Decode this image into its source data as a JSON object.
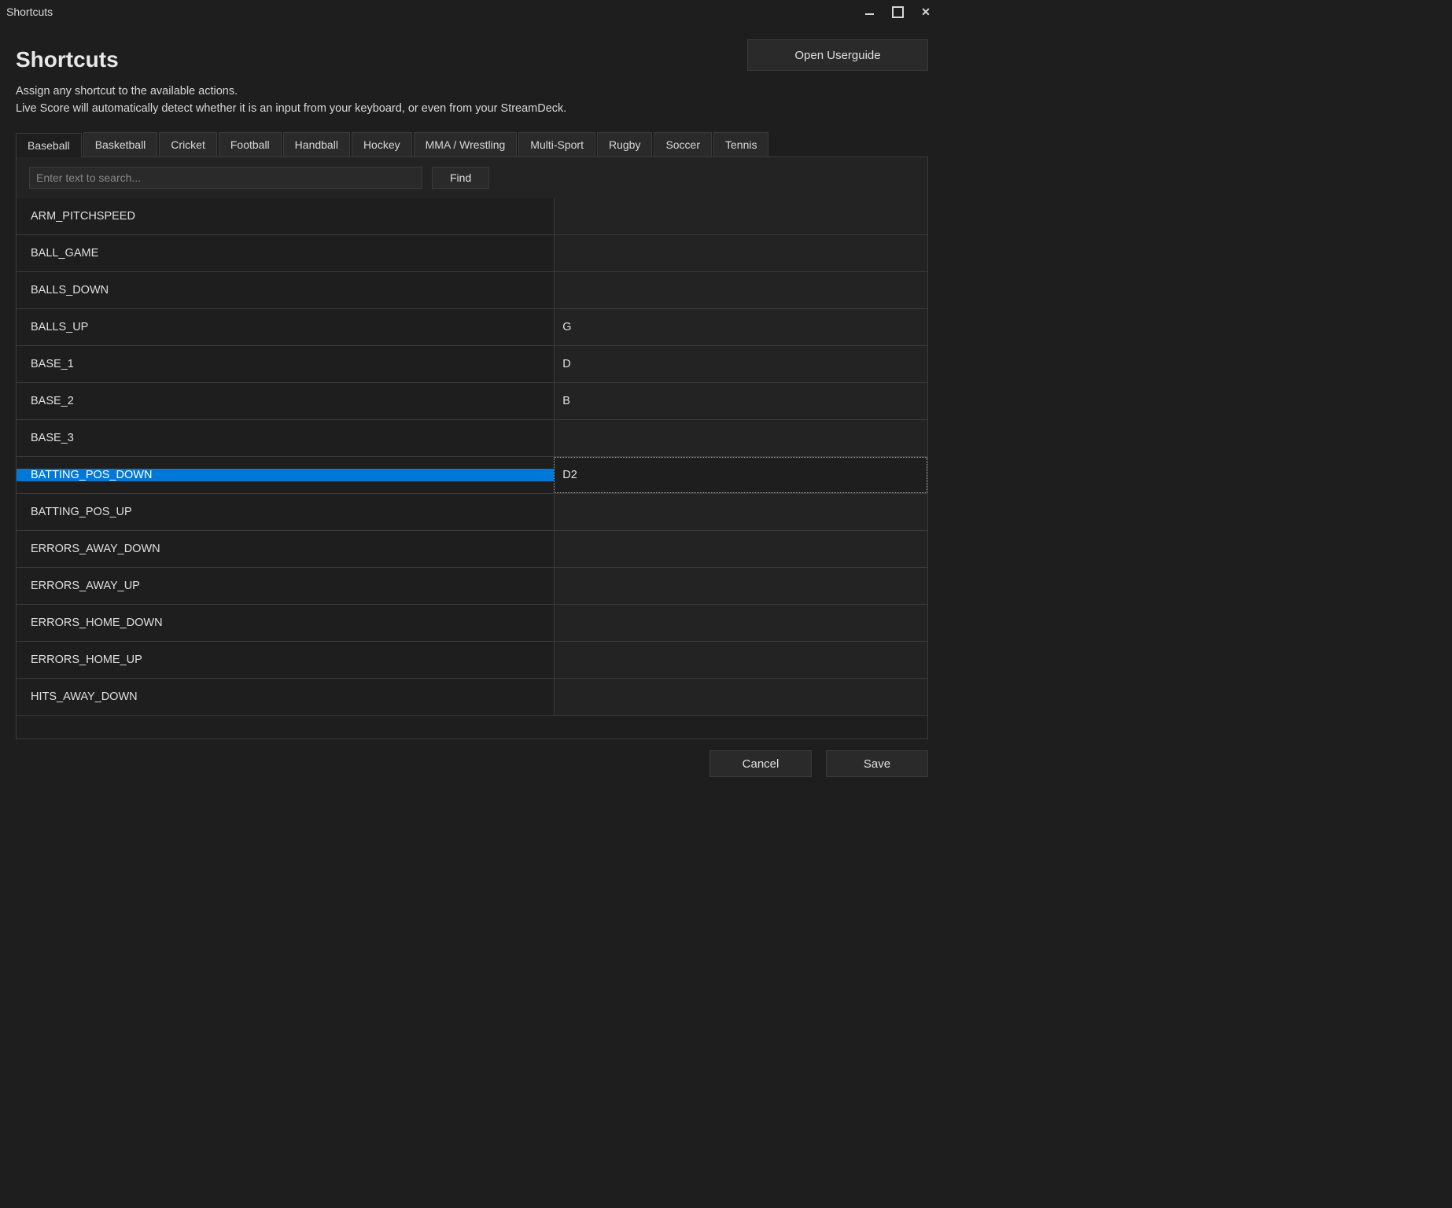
{
  "window": {
    "title": "Shortcuts"
  },
  "header": {
    "title": "Shortcuts",
    "open_guide": "Open Userguide",
    "subtitle_line1": "Assign any shortcut to the available actions.",
    "subtitle_line2": "Live Score will automatically detect whether it is an input from your keyboard, or even from your StreamDeck."
  },
  "tabs": [
    {
      "label": "Baseball",
      "active": true
    },
    {
      "label": "Basketball",
      "active": false
    },
    {
      "label": "Cricket",
      "active": false
    },
    {
      "label": "Football",
      "active": false
    },
    {
      "label": "Handball",
      "active": false
    },
    {
      "label": "Hockey",
      "active": false
    },
    {
      "label": "MMA / Wrestling",
      "active": false
    },
    {
      "label": "Multi-Sport",
      "active": false
    },
    {
      "label": "Rugby",
      "active": false
    },
    {
      "label": "Soccer",
      "active": false
    },
    {
      "label": "Tennis",
      "active": false
    }
  ],
  "search": {
    "placeholder": "Enter text to search...",
    "find": "Find"
  },
  "rows": [
    {
      "action": "ARM_PITCHSPEED",
      "key": "",
      "selected": false
    },
    {
      "action": "BALL_GAME",
      "key": "",
      "selected": false
    },
    {
      "action": "BALLS_DOWN",
      "key": "",
      "selected": false
    },
    {
      "action": "BALLS_UP",
      "key": "G",
      "selected": false
    },
    {
      "action": "BASE_1",
      "key": "D",
      "selected": false
    },
    {
      "action": "BASE_2",
      "key": "B",
      "selected": false
    },
    {
      "action": "BASE_3",
      "key": "",
      "selected": false
    },
    {
      "action": "BATTING_POS_DOWN",
      "key": "D2",
      "selected": true
    },
    {
      "action": "BATTING_POS_UP",
      "key": "",
      "selected": false
    },
    {
      "action": "ERRORS_AWAY_DOWN",
      "key": "",
      "selected": false
    },
    {
      "action": "ERRORS_AWAY_UP",
      "key": "",
      "selected": false
    },
    {
      "action": "ERRORS_HOME_DOWN",
      "key": "",
      "selected": false
    },
    {
      "action": "ERRORS_HOME_UP",
      "key": "",
      "selected": false
    },
    {
      "action": "HITS_AWAY_DOWN",
      "key": "",
      "selected": false
    }
  ],
  "footer": {
    "cancel": "Cancel",
    "save": "Save"
  }
}
